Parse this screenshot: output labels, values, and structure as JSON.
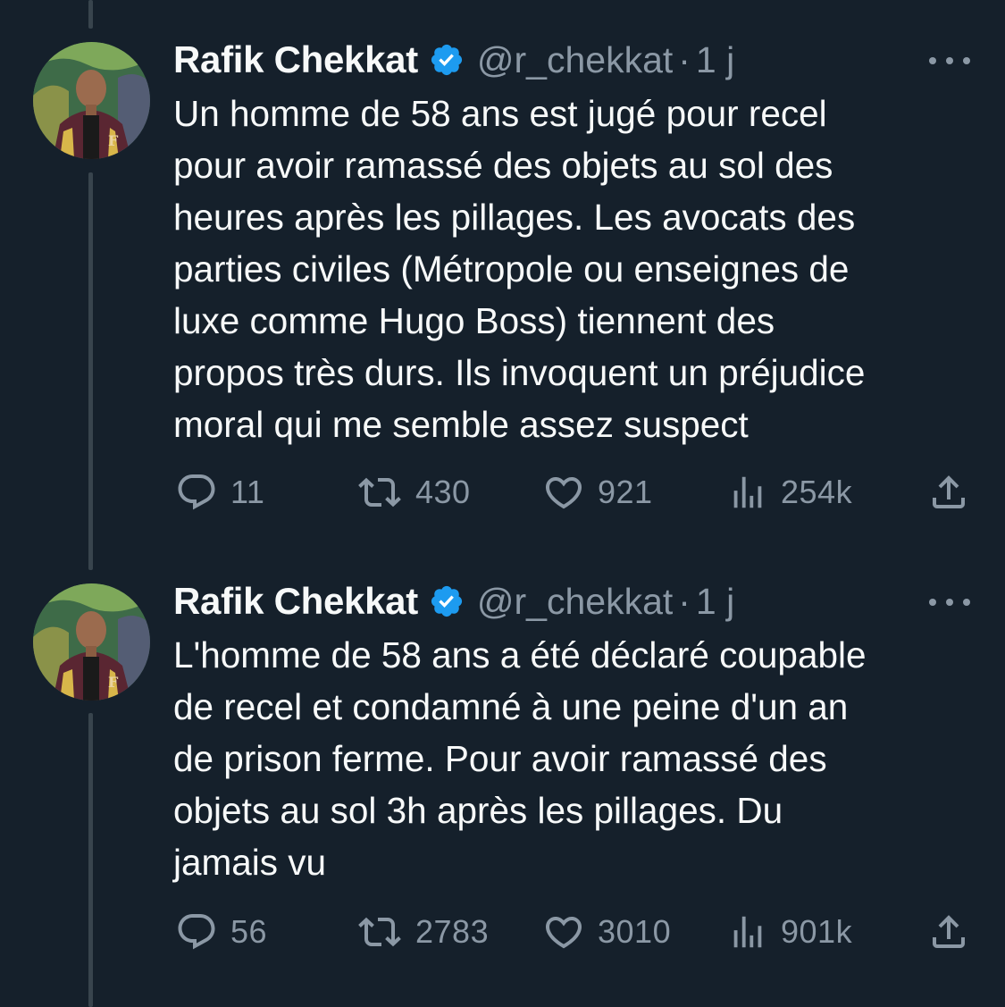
{
  "theme": {
    "background": "#15202b",
    "text": "#f7f9f9",
    "muted": "#8b98a5",
    "verified": "#1d9bf0",
    "thread_line": "#38444d"
  },
  "tweets": [
    {
      "author": {
        "name": "Rafik Chekkat",
        "handle": "@r_chekkat",
        "verified_icon": "verified-badge-icon"
      },
      "separator": "·",
      "time": "1 j",
      "more_icon": "more-options-icon",
      "text_lines": [
        "Un homme de 58 ans est jugé pour recel",
        "pour avoir ramassé des objets au sol des",
        "heures après les pillages. Les avocats des",
        "parties civiles (Métropole ou enseignes de",
        "luxe comme Hugo Boss) tiennent des",
        "propos très durs. Ils invoquent un préjudice",
        "moral qui me semble assez suspect"
      ],
      "actions": {
        "replies": "11",
        "retweets": "430",
        "likes": "921",
        "views": "254k"
      }
    },
    {
      "author": {
        "name": "Rafik Chekkat",
        "handle": "@r_chekkat",
        "verified_icon": "verified-badge-icon"
      },
      "separator": "·",
      "time": "1 j",
      "more_icon": "more-options-icon",
      "text_lines": [
        "L'homme de 58 ans a été déclaré coupable",
        "de recel et condamné à une peine d'un an",
        "de prison ferme. Pour avoir ramassé des",
        "objets au sol 3h après les pillages. Du",
        "jamais vu"
      ],
      "actions": {
        "replies": "56",
        "retweets": "2783",
        "likes": "3010",
        "views": "901k"
      }
    }
  ]
}
